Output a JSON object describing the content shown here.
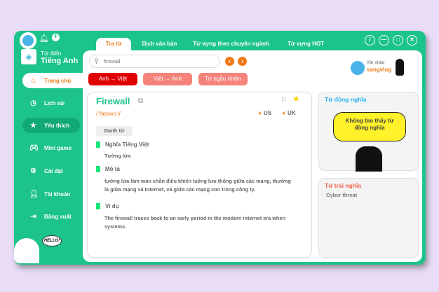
{
  "app": {
    "title_line1": "Từ điển",
    "title_line2": "Tiếng Anh"
  },
  "tabs": [
    {
      "label": "Tra từ"
    },
    {
      "label": "Dịch văn bản"
    },
    {
      "label": "Từ vựng theo chuyên ngành"
    },
    {
      "label": "Từ vựng HOT"
    }
  ],
  "window_buttons": {
    "info": "i"
  },
  "sidebar": {
    "items": [
      {
        "label": "Trang chủ",
        "icon": "home-icon"
      },
      {
        "label": "Lịch sử",
        "icon": "history-icon"
      },
      {
        "label": "Yêu thích",
        "icon": "star-icon"
      },
      {
        "label": "Mini game",
        "icon": "gamepad-icon"
      },
      {
        "label": "Cài đặt",
        "icon": "gear-icon"
      },
      {
        "label": "Tài khoản",
        "icon": "user-icon"
      },
      {
        "label": "Đăng xuất",
        "icon": "logout-icon"
      }
    ],
    "mascot_text": "HELLO!"
  },
  "search": {
    "value": "firewall"
  },
  "modes": [
    {
      "label": "Anh → Việt"
    },
    {
      "label": "Việt → Anh"
    },
    {
      "label": "Từ ngẫu nhiên"
    }
  ],
  "user": {
    "greeting": "Xin chào",
    "name": "sangvlog"
  },
  "word": {
    "term": "Firewall",
    "phonetic": "/ˈfaɪəwɔːl/",
    "us": "US",
    "uk": "UK",
    "pos": "Danh từ",
    "meaning_label": "Nghĩa Tiếng Việt",
    "meaning": "Tường lửa",
    "desc_label": "Mô tả",
    "desc": "tường lửa làm màn chắn điều khiển luồng lưu thông giữa các mạng, thường là giữa mạng và Internet, và giữa các mạng con trong công ty.",
    "example_label": "Ví dụ",
    "example": "The firewall traces back to an early period in the modern internet era when systems."
  },
  "synonyms": {
    "title": "Từ đồng nghĩa",
    "empty": "Không tìm thấy từ đồng nghĩa"
  },
  "antonyms": {
    "title": "Từ trái nghĩa",
    "items": [
      "Cyber threat"
    ]
  },
  "colors": {
    "green": "#1cc38c",
    "orange": "#f07a18",
    "red": "#e00000",
    "salmon": "#f5837a"
  }
}
